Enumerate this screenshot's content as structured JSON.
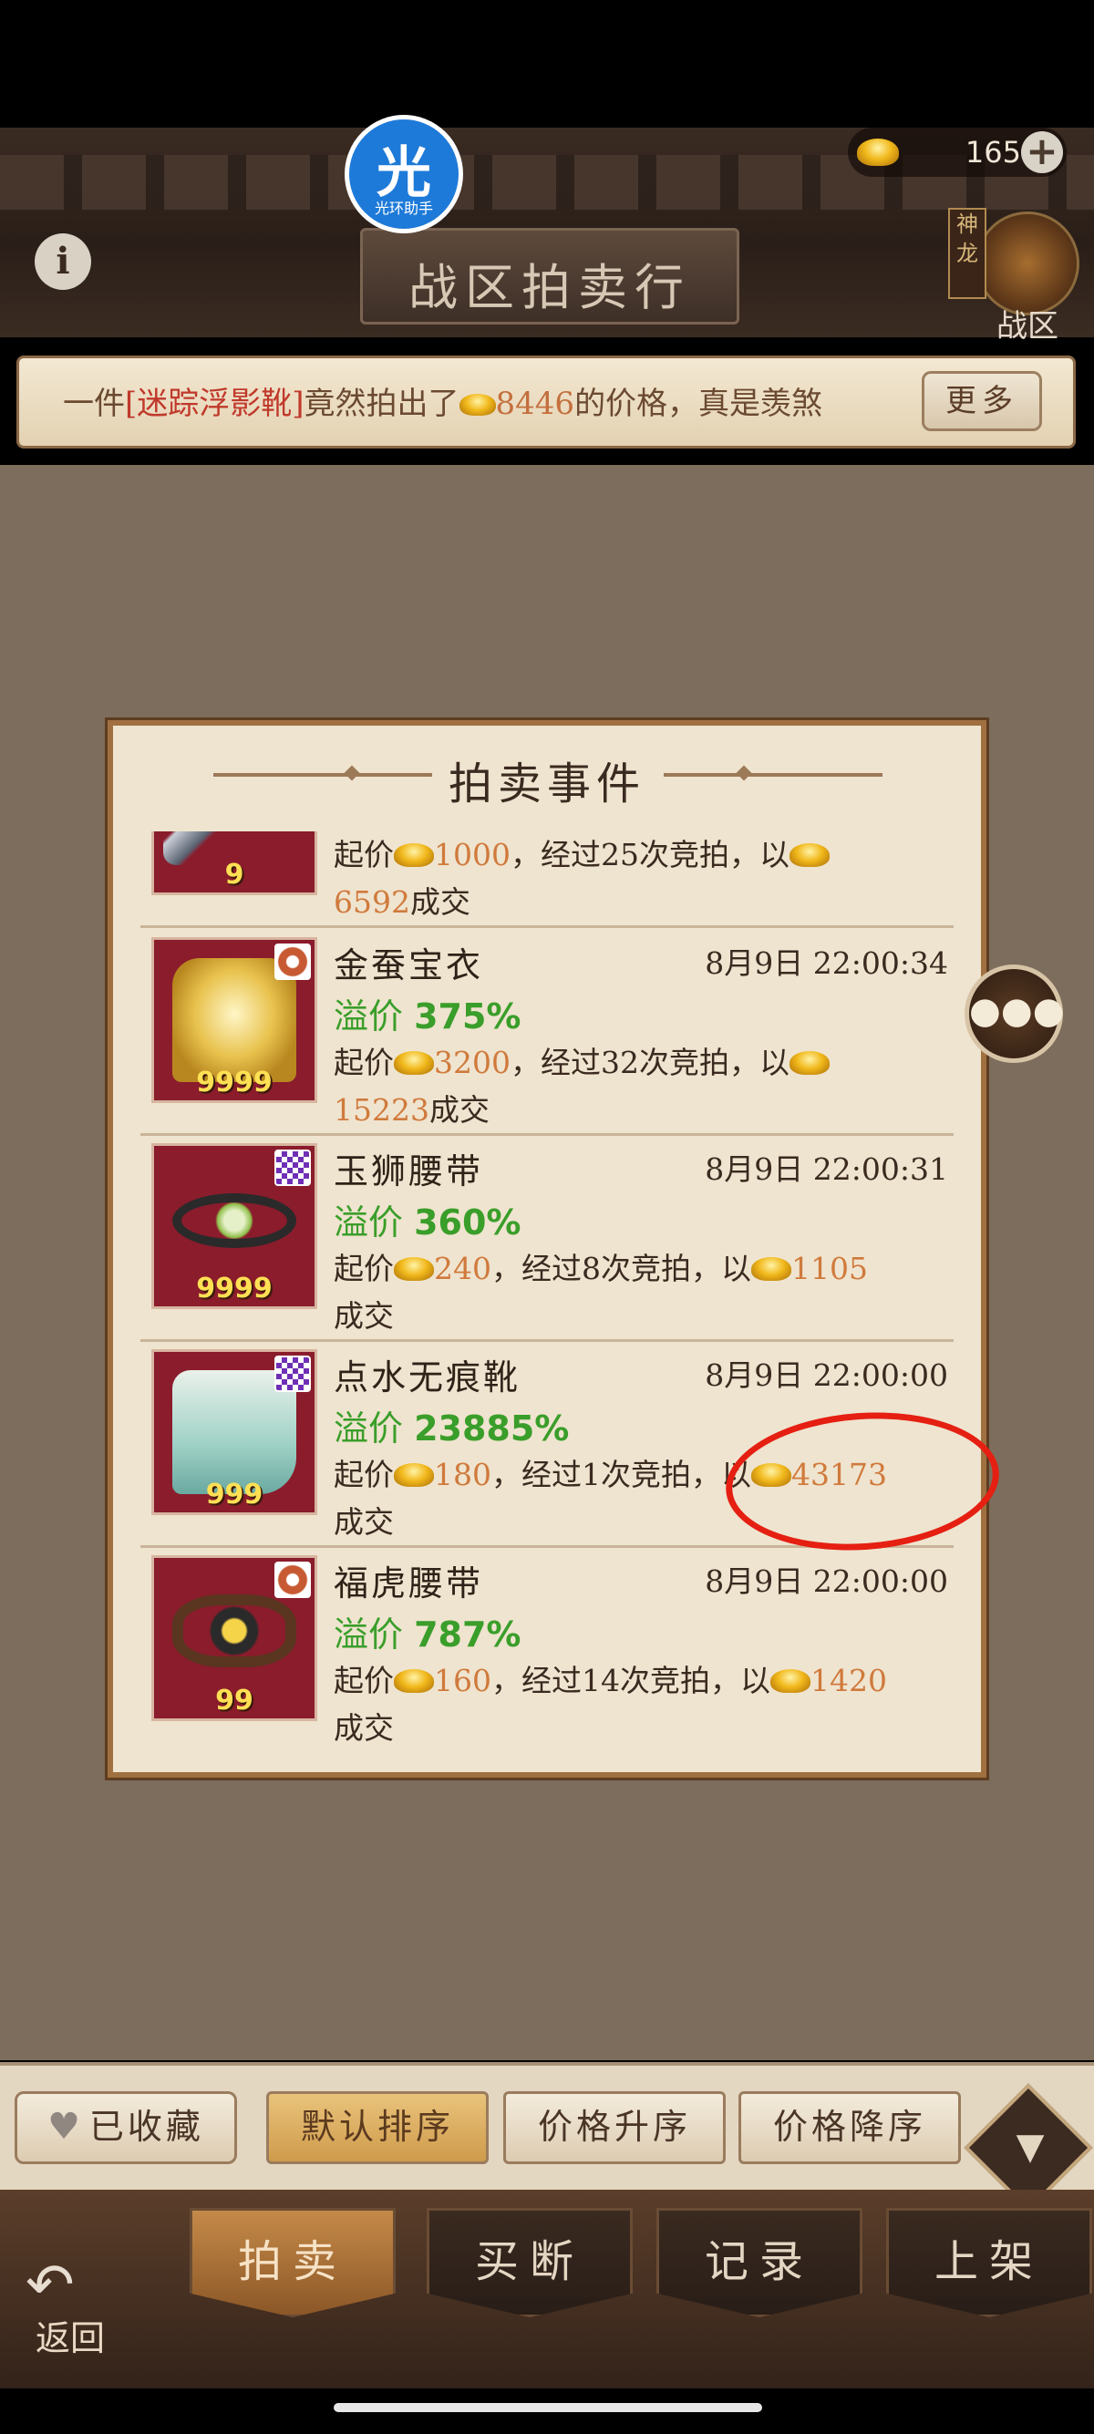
{
  "header": {
    "title": "战区拍卖行",
    "gold": "165",
    "gold_add": "+",
    "info": "i",
    "region_tag": "神龙",
    "region_label": "战区",
    "helper_badge": {
      "char": "光",
      "label": "光环助手"
    }
  },
  "news": {
    "prefix": "一件",
    "item": "[迷踪浮影靴]",
    "middle": "竟然拍出了",
    "price": "8446",
    "suffix": "的价格，真是羡煞",
    "more": "更多"
  },
  "dialog": {
    "title": "拍卖事件",
    "events": [
      {
        "name": "",
        "time": "",
        "premium_label": "溢价",
        "premium": "",
        "start_label": "起价",
        "start_price": "1000",
        "bids_text": "，经过25次竞拍，以",
        "final_price": "6592",
        "deal": "成交",
        "qty": "9"
      },
      {
        "name": "金蚕宝衣",
        "time": "8月9日  22:00:34",
        "premium_label": "溢价",
        "premium": "375%",
        "start_label": "起价",
        "start_price": "3200",
        "bids_text": "，经过32次竞拍，以",
        "final_price": "15223",
        "deal": "成交",
        "qty": "9999"
      },
      {
        "name": "玉狮腰带",
        "time": "8月9日  22:00:31",
        "premium_label": "溢价",
        "premium": "360%",
        "start_label": "起价",
        "start_price": "240",
        "bids_text": "，经过8次竞拍，以",
        "final_price": "1105",
        "deal": "成交",
        "qty": "9999"
      },
      {
        "name": "点水无痕靴",
        "time": "8月9日  22:00:00",
        "premium_label": "溢价",
        "premium": "23885%",
        "start_label": "起价",
        "start_price": "180",
        "bids_text": "，经过1次竞拍，以",
        "final_price": "43173",
        "deal": "成交",
        "qty": "999"
      },
      {
        "name": "福虎腰带",
        "time": "8月9日  22:00:00",
        "premium_label": "溢价",
        "premium": "787%",
        "start_label": "起价",
        "start_price": "160",
        "bids_text": "，经过14次竞拍，以",
        "final_price": "1420",
        "deal": "成交",
        "qty": "99"
      }
    ]
  },
  "sort_bar": {
    "favorites": "已收藏",
    "default": "默认排序",
    "asc": "价格升序",
    "desc": "价格降序"
  },
  "tabs": {
    "auction": "拍卖",
    "buyout": "买断",
    "records": "记录",
    "list": "上架"
  },
  "back": "返回",
  "colors": {
    "premium_green": "#3a9e2a",
    "price_orange": "#d07a3c",
    "annotation_red": "#e51f12",
    "item_bg": "#8a1c2c"
  }
}
